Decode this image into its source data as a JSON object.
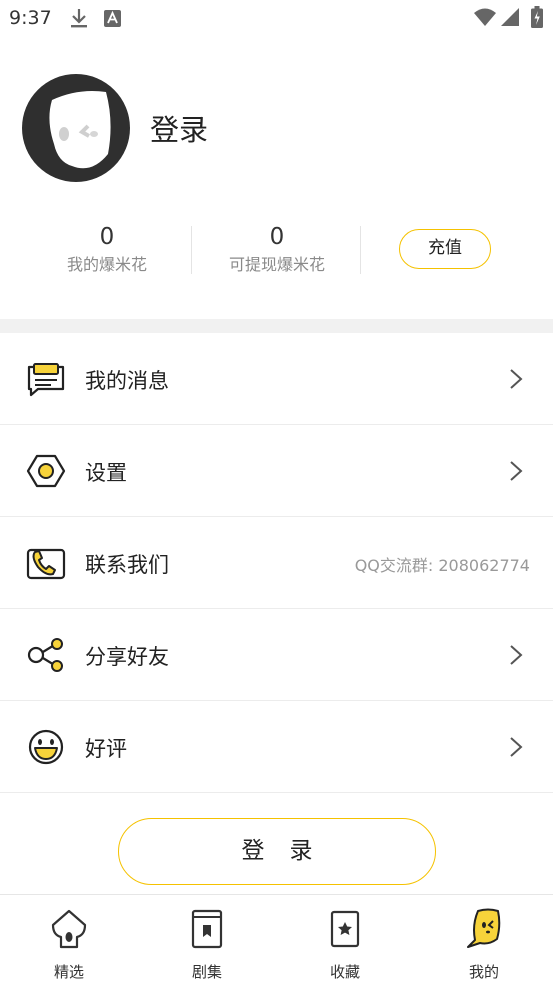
{
  "status_bar": {
    "time": "9:37",
    "icons": [
      "download-icon",
      "a-notification-icon",
      "wifi-icon",
      "signal-icon",
      "battery-icon"
    ]
  },
  "profile": {
    "login_title": "登录",
    "avatar_icon": "avatar-placeholder-icon"
  },
  "stats": {
    "popcorn": {
      "value": "0",
      "label": "我的爆米花"
    },
    "withdrawable": {
      "value": "0",
      "label": "可提现爆米花"
    },
    "recharge_label": "充值"
  },
  "menu": {
    "items": [
      {
        "label": "我的消息",
        "icon": "message-icon"
      },
      {
        "label": "设置",
        "icon": "settings-icon"
      },
      {
        "label": "联系我们",
        "icon": "phone-icon",
        "extra": "QQ交流群: 208062774"
      },
      {
        "label": "分享好友",
        "icon": "share-icon"
      },
      {
        "label": "好评",
        "icon": "smile-icon"
      }
    ]
  },
  "login_button": "登录",
  "bottom_nav": {
    "items": [
      {
        "label": "精选",
        "icon": "featured-icon"
      },
      {
        "label": "剧集",
        "icon": "episodes-icon"
      },
      {
        "label": "收藏",
        "icon": "favorites-icon"
      },
      {
        "label": "我的",
        "icon": "mine-icon"
      }
    ]
  },
  "colors": {
    "accent": "#f5c200",
    "accent_fill": "#f7d33a",
    "text": "#222222",
    "muted": "#8a8a8a",
    "divider": "#ececec"
  }
}
